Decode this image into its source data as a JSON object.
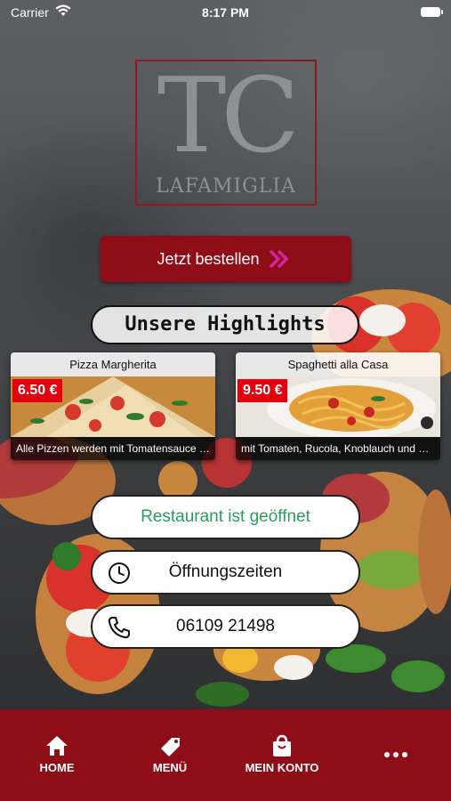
{
  "status_bar": {
    "carrier": "Carrier",
    "time": "8:17 PM"
  },
  "logo": {
    "monogram": "TC",
    "subtitle": "LAFAMIGLIA"
  },
  "order_button": {
    "label": "Jetzt bestellen"
  },
  "highlights": {
    "title": "Unsere Highlights",
    "items": [
      {
        "name": "Pizza Margherita",
        "price": "6.50 €",
        "description": "Alle Pizzen werden mit Tomatensauce u..."
      },
      {
        "name": "Spaghetti alla Casa",
        "price": "9.50 €",
        "description": "mit Tomaten, Rucola, Knoblauch und Pe..."
      }
    ]
  },
  "status_pill": {
    "label": "Restaurant ist geöffnet",
    "color": "#2aa05a"
  },
  "hours_pill": {
    "label": "Öffnungszeiten",
    "icon": "clock-icon"
  },
  "phone_pill": {
    "label": "06109 21498",
    "icon": "phone-icon"
  },
  "tab_bar": {
    "color": "#8e0d17",
    "tabs": [
      {
        "label": "HOME",
        "icon": "home-icon"
      },
      {
        "label": "MENÜ",
        "icon": "tag-icon"
      },
      {
        "label": "MEIN KONTO",
        "icon": "shopping-bag-icon"
      },
      {
        "label": "",
        "icon": "more-dots-icon"
      }
    ]
  },
  "colors": {
    "accent": "#8e0d17",
    "price_badge": "#e3000f",
    "arrow": "#d6249f"
  }
}
